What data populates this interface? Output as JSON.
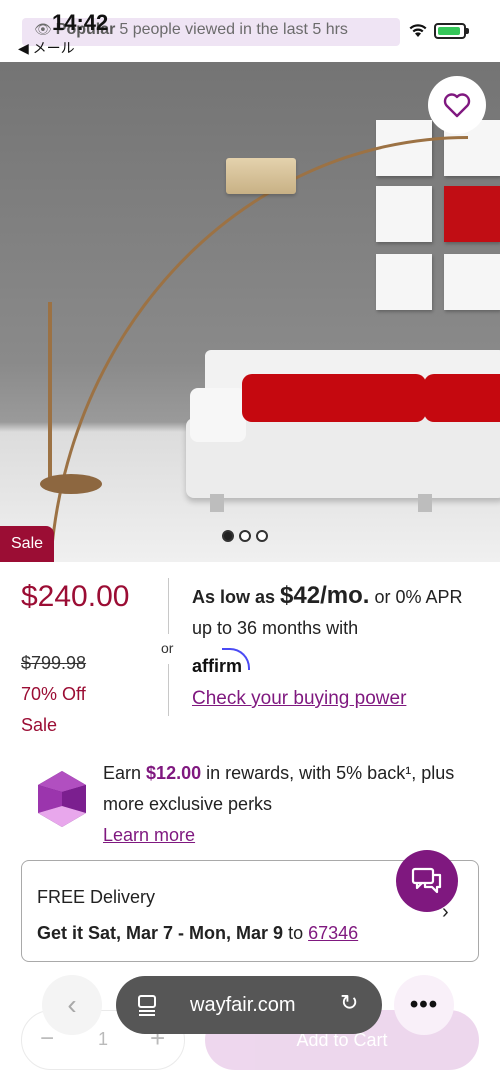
{
  "status_bar": {
    "time": "14:42",
    "back_app": "◀ メール"
  },
  "popular": {
    "label": "Popular",
    "text": "5 people viewed in the last 5 hrs"
  },
  "gallery": {
    "sale_tag": "Sale",
    "image_count": 3,
    "active_index": 0
  },
  "pricing": {
    "price": "$240.00",
    "was_price": "$799.98",
    "discount": "70% Off",
    "sale_label": "Sale",
    "or_label": "or",
    "financing_prefix": "As low as",
    "financing_amount": "$42/mo.",
    "financing_suffix": "or 0% APR up to 36 months with",
    "financing_provider": "affirm",
    "buying_power_link": "Check your buying power"
  },
  "rewards": {
    "text_before": "Earn",
    "amount": "$12.00",
    "text_after": "in rewards, with 5% back¹, plus more exclusive perks",
    "learn_more": "Learn more"
  },
  "delivery": {
    "title": "FREE Delivery",
    "dates": "Get it Sat, Mar 7 - Mon, Mar 9",
    "to_label": "to",
    "zip": "67346"
  },
  "cart": {
    "quantity": "1",
    "add_to_cart": "Add to Cart"
  },
  "browser": {
    "url": "wayfair.com",
    "more": "•••"
  },
  "colors": {
    "brand_purple": "#7f187f",
    "sale_red": "#9b0d34"
  }
}
